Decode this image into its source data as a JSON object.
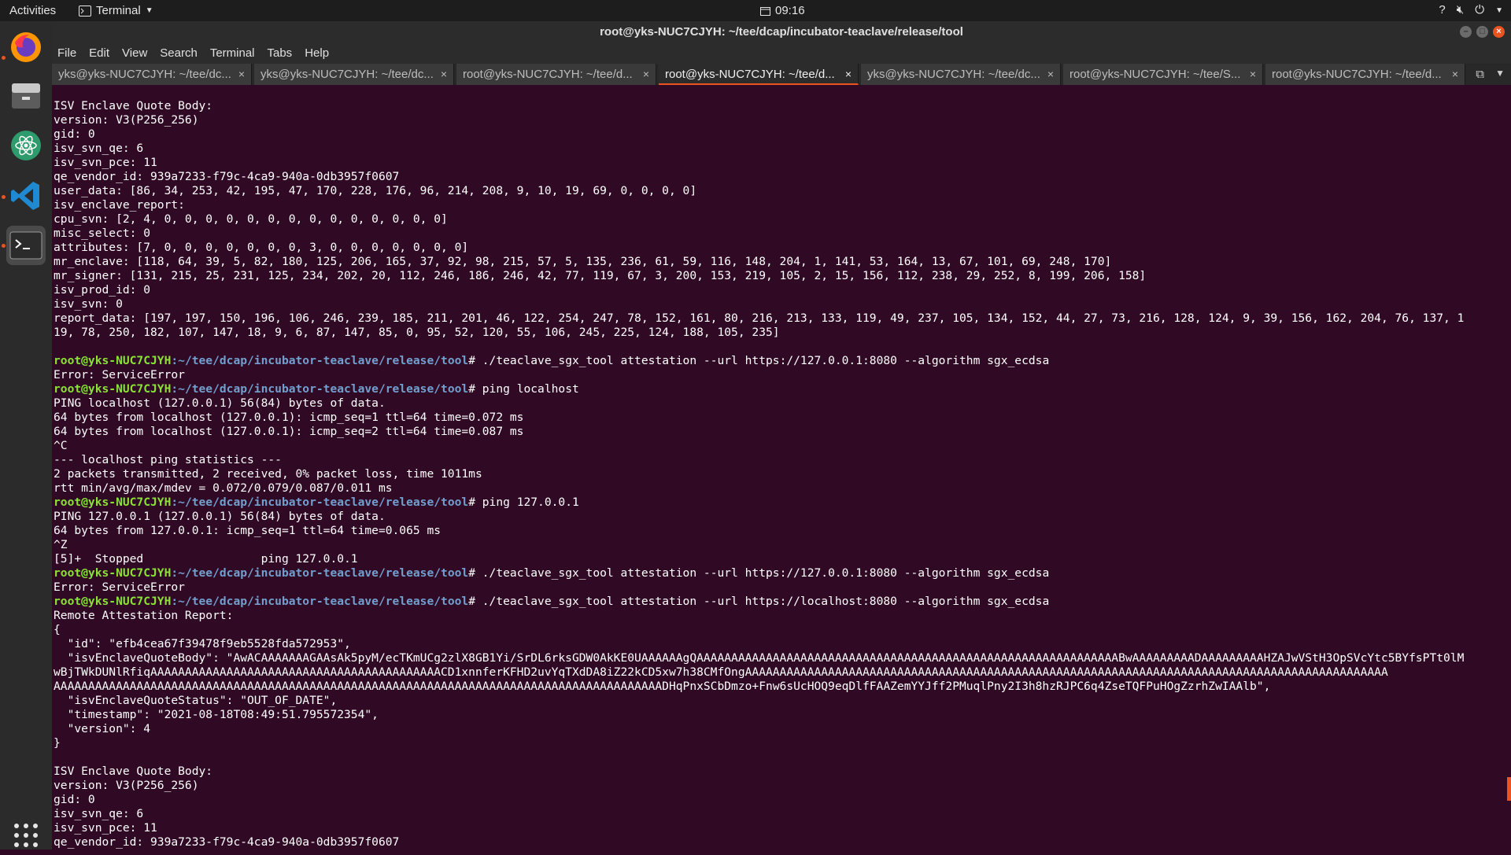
{
  "topbar": {
    "activities": "Activities",
    "app_name": "Terminal",
    "clock": "09:16",
    "help": "?"
  },
  "window": {
    "title": "root@yks-NUC7CJYH: ~/tee/dcap/incubator-teaclave/release/tool"
  },
  "menu": [
    "File",
    "Edit",
    "View",
    "Search",
    "Terminal",
    "Tabs",
    "Help"
  ],
  "tabs": [
    "yks@yks-NUC7CJYH: ~/tee/dc...",
    "yks@yks-NUC7CJYH: ~/tee/dc...",
    "root@yks-NUC7CJYH: ~/tee/d...",
    "root@yks-NUC7CJYH: ~/tee/d...",
    "yks@yks-NUC7CJYH: ~/tee/dc...",
    "root@yks-NUC7CJYH: ~/tee/S...",
    "root@yks-NUC7CJYH: ~/tee/d..."
  ],
  "active_tab": 3,
  "prompt": {
    "user_host": "root@yks-NUC7CJYH",
    "path": ":~/tee/dcap/incubator-teaclave/release/tool"
  },
  "lines": [
    {
      "text": "ISV Enclave Quote Body:"
    },
    {
      "text": "version: V3(P256_256)"
    },
    {
      "text": "gid: 0"
    },
    {
      "text": "isv_svn_qe: 6"
    },
    {
      "text": "isv_svn_pce: 11"
    },
    {
      "text": "qe_vendor_id: 939a7233-f79c-4ca9-940a-0db3957f0607"
    },
    {
      "text": "user_data: [86, 34, 253, 42, 195, 47, 170, 228, 176, 96, 214, 208, 9, 10, 19, 69, 0, 0, 0, 0]"
    },
    {
      "text": "isv_enclave_report:"
    },
    {
      "text": "cpu_svn: [2, 4, 0, 0, 0, 0, 0, 0, 0, 0, 0, 0, 0, 0, 0, 0]"
    },
    {
      "text": "misc_select: 0"
    },
    {
      "text": "attributes: [7, 0, 0, 0, 0, 0, 0, 0, 3, 0, 0, 0, 0, 0, 0, 0]"
    },
    {
      "text": "mr_enclave: [118, 64, 39, 5, 82, 180, 125, 206, 165, 37, 92, 98, 215, 57, 5, 135, 236, 61, 59, 116, 148, 204, 1, 141, 53, 164, 13, 67, 101, 69, 248, 170]"
    },
    {
      "text": "mr_signer: [131, 215, 25, 231, 125, 234, 202, 20, 112, 246, 186, 246, 42, 77, 119, 67, 3, 200, 153, 219, 105, 2, 15, 156, 112, 238, 29, 252, 8, 199, 206, 158]"
    },
    {
      "text": "isv_prod_id: 0"
    },
    {
      "text": "isv_svn: 0"
    },
    {
      "text": "report_data: [197, 197, 150, 196, 106, 246, 239, 185, 211, 201, 46, 122, 254, 247, 78, 152, 161, 80, 216, 213, 133, 119, 49, 237, 105, 134, 152, 44, 27, 73, 216, 128, 124, 9, 39, 156, 162, 204, 76, 137, 1"
    },
    {
      "text": "19, 78, 250, 182, 107, 147, 18, 9, 6, 87, 147, 85, 0, 95, 52, 120, 55, 106, 245, 225, 124, 188, 105, 235]"
    },
    {
      "text": ""
    },
    {
      "prompt": true,
      "text": "# ./teaclave_sgx_tool attestation --url https://127.0.0.1:8080 --algorithm sgx_ecdsa"
    },
    {
      "text": "Error: ServiceError"
    },
    {
      "prompt": true,
      "text": "# ping localhost"
    },
    {
      "text": "PING localhost (127.0.0.1) 56(84) bytes of data."
    },
    {
      "text": "64 bytes from localhost (127.0.0.1): icmp_seq=1 ttl=64 time=0.072 ms"
    },
    {
      "text": "64 bytes from localhost (127.0.0.1): icmp_seq=2 ttl=64 time=0.087 ms"
    },
    {
      "text": "^C"
    },
    {
      "text": "--- localhost ping statistics ---"
    },
    {
      "text": "2 packets transmitted, 2 received, 0% packet loss, time 1011ms"
    },
    {
      "text": "rtt min/avg/max/mdev = 0.072/0.079/0.087/0.011 ms"
    },
    {
      "prompt": true,
      "text": "# ping 127.0.0.1"
    },
    {
      "text": "PING 127.0.0.1 (127.0.0.1) 56(84) bytes of data."
    },
    {
      "text": "64 bytes from 127.0.0.1: icmp_seq=1 ttl=64 time=0.065 ms"
    },
    {
      "text": "^Z"
    },
    {
      "text": "[5]+  Stopped                 ping 127.0.0.1"
    },
    {
      "prompt": true,
      "text": "# ./teaclave_sgx_tool attestation --url https://127.0.0.1:8080 --algorithm sgx_ecdsa"
    },
    {
      "text": "Error: ServiceError"
    },
    {
      "prompt": true,
      "text": "# ./teaclave_sgx_tool attestation --url https://localhost:8080 --algorithm sgx_ecdsa"
    },
    {
      "text": "Remote Attestation Report:"
    },
    {
      "text": "{"
    },
    {
      "text": "  \"id\": \"efb4cea67f39478f9eb5528fda572953\","
    },
    {
      "text": "  \"isvEnclaveQuoteBody\": \"AwACAAAAAAAGAAsAk5pyM/ecTKmUCg2zlX8GB1Yi/SrDL6rksGDW0AkKE0UAAAAAAgQAAAAAAAAAAAAAAAAAAAAAAAAAAAAAAAAAAAAAAAAAAAAAAAAAAAAAAAAAAAAABwAAAAAAAAADAAAAAAAAAHZAJwVStH3OpSVcYtc5BYfsPTt0lM"
    },
    {
      "text": "wBjTWkDUNlRfiqAAAAAAAAAAAAAAAAAAAAAAAAAAAAAAAAAAAAAAAAAACD1xnnferKFHD2uvYqTXdDA8iZ22kCD5xw7h38CMfOngAAAAAAAAAAAAAAAAAAAAAAAAAAAAAAAAAAAAAAAAAAAAAAAAAAAAAAAAAAAAAAAAAAAAAAAAAAAAAAAAAAAAAAAAAAAAA"
    },
    {
      "text": "AAAAAAAAAAAAAAAAAAAAAAAAAAAAAAAAAAAAAAAAAAAAAAAAAAAAAAAAAAAAAAAAAAAAAAAAAAAAAAAAAAAAAAAADHqPnxSCbDmzo+Fnw6sUcHOQ9eqDlfFAAZemYYJff2PMuqlPny2I3h8hzRJPC6q4ZseTQFPuHOgZzrhZwIAAlb\","
    },
    {
      "text": "  \"isvEnclaveQuoteStatus\": \"OUT_OF_DATE\","
    },
    {
      "text": "  \"timestamp\": \"2021-08-18T08:49:51.795572354\","
    },
    {
      "text": "  \"version\": 4"
    },
    {
      "text": "}"
    },
    {
      "text": ""
    },
    {
      "text": "ISV Enclave Quote Body:"
    },
    {
      "text": "version: V3(P256_256)"
    },
    {
      "text": "gid: 0"
    },
    {
      "text": "isv_svn_qe: 6"
    },
    {
      "text": "isv_svn_pce: 11"
    },
    {
      "text": "qe_vendor_id: 939a7233-f79c-4ca9-940a-0db3957f0607"
    }
  ],
  "colors": {
    "background": "#300a24",
    "prompt_user": "#8ae234",
    "prompt_path": "#729fcf",
    "accent": "#e95420"
  }
}
